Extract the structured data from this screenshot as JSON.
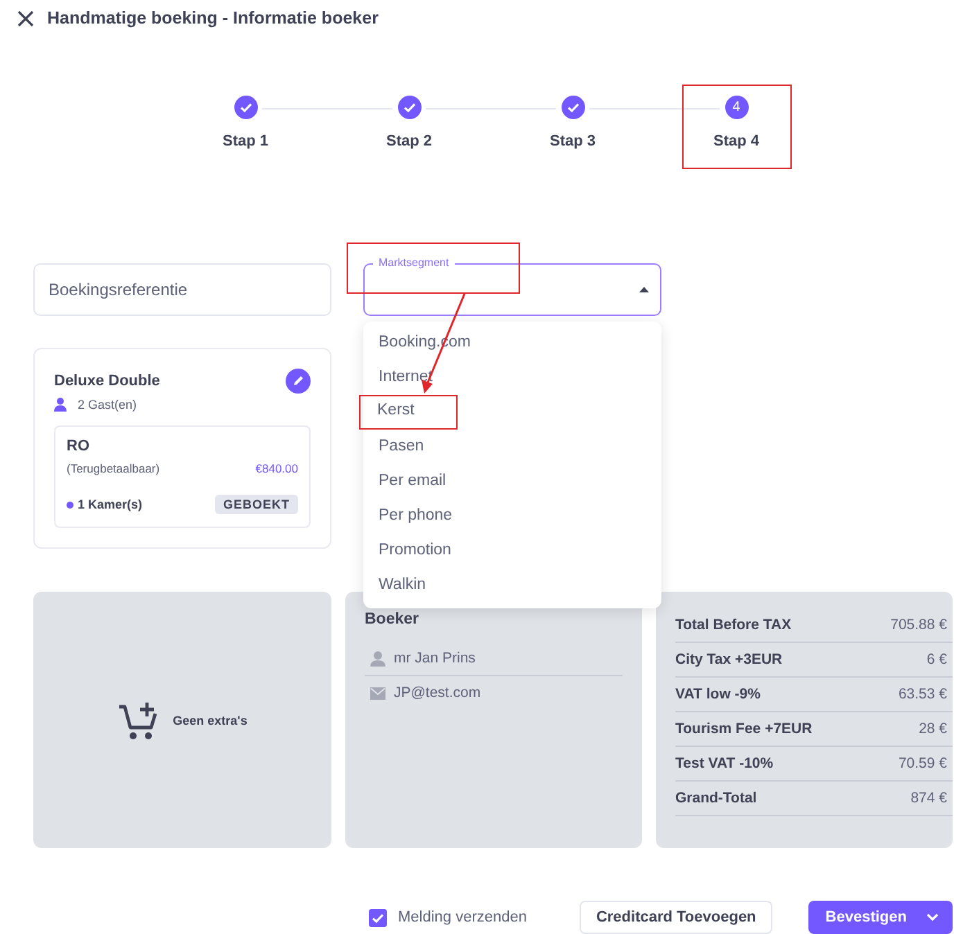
{
  "window": {
    "title": "Handmatige boeking - Informatie boeker"
  },
  "steps": [
    {
      "label": "Stap 1",
      "completed": true,
      "highlighted": false
    },
    {
      "label": "Stap 2",
      "completed": true,
      "highlighted": false
    },
    {
      "label": "Stap 3",
      "completed": true,
      "highlighted": false
    },
    {
      "label": "Stap 4",
      "number": "4",
      "completed": false,
      "highlighted": true
    }
  ],
  "booking_reference": {
    "placeholder": "Boekingsreferentie"
  },
  "market_segment": {
    "label": "Marktsegment",
    "label_highlighted": true,
    "expanded": true,
    "options": [
      {
        "label": "Booking.com",
        "highlighted": false
      },
      {
        "label": "Internet",
        "highlighted": false
      },
      {
        "label": "Kerst",
        "highlighted": true
      },
      {
        "label": "Pasen",
        "highlighted": false
      },
      {
        "label": "Per email",
        "highlighted": false
      },
      {
        "label": "Per phone",
        "highlighted": false
      },
      {
        "label": "Promotion",
        "highlighted": false
      },
      {
        "label": "Walkin",
        "highlighted": false
      }
    ]
  },
  "room": {
    "name": "Deluxe Double",
    "guests": "2 Gast(en)",
    "rate": {
      "code": "RO",
      "policy": "(Terugbetaalbaar)",
      "price": "€840.00",
      "rooms": "1 Kamer(s)",
      "status": "GEBOEKT"
    }
  },
  "extras": {
    "empty_text": "Geen extra's"
  },
  "booker": {
    "title": "Boeker",
    "name": "mr Jan Prins",
    "email": "JP@test.com"
  },
  "totals": [
    {
      "label": "Total Before TAX",
      "value": "705.88 €"
    },
    {
      "label": "City Tax +3EUR",
      "value": "6 €"
    },
    {
      "label": "VAT low -9%",
      "value": "63.53 €"
    },
    {
      "label": "Tourism Fee +7EUR",
      "value": "28 €"
    },
    {
      "label": "Test VAT -10%",
      "value": "70.59 €"
    },
    {
      "label": "Grand-Total",
      "value": "874 €"
    }
  ],
  "footer": {
    "notify": {
      "label": "Melding verzenden",
      "checked": true
    },
    "buttons": [
      {
        "label": "Creditcard Toevoegen",
        "kind": "secondary"
      },
      {
        "label": "Bevestigen",
        "kind": "primary"
      }
    ]
  }
}
